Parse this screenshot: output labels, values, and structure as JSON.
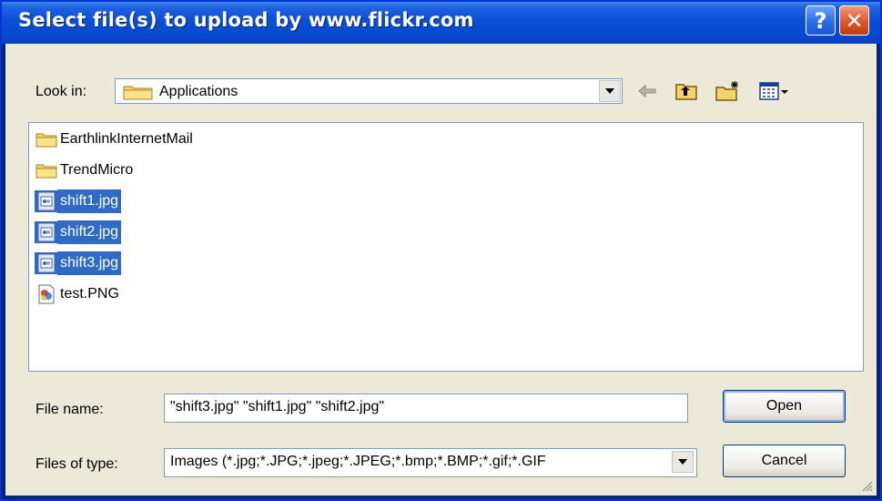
{
  "window": {
    "title": "Select file(s) to upload by www.flickr.com",
    "help_label": "?",
    "close_label": "✕"
  },
  "lookin": {
    "label": "Look in:",
    "value": "Applications"
  },
  "toolbar": {
    "icons": [
      "back-arrow-icon",
      "up-folder-icon",
      "new-folder-icon",
      "view-menu-icon"
    ]
  },
  "files": [
    {
      "name": "EarthlinkInternetMail",
      "type": "folder",
      "selected": false
    },
    {
      "name": "TrendMicro",
      "type": "folder",
      "selected": false
    },
    {
      "name": "shift1.jpg",
      "type": "jpg",
      "selected": true
    },
    {
      "name": "shift2.jpg",
      "type": "jpg",
      "selected": true
    },
    {
      "name": "shift3.jpg",
      "type": "jpg",
      "selected": true
    },
    {
      "name": "test.PNG",
      "type": "png",
      "selected": false
    }
  ],
  "filename": {
    "label": "File name:",
    "value": "\"shift3.jpg\" \"shift1.jpg\" \"shift2.jpg\""
  },
  "filetype": {
    "label": "Files of type:",
    "value": "Images (*.jpg;*.JPG;*.jpeg;*.JPEG;*.bmp;*.BMP;*.gif;*.GIF"
  },
  "buttons": {
    "open": "Open",
    "cancel": "Cancel"
  },
  "colors": {
    "titlebar": "#0a4fd8",
    "selection": "#316ac5",
    "dialog_bg": "#ece9d8"
  }
}
